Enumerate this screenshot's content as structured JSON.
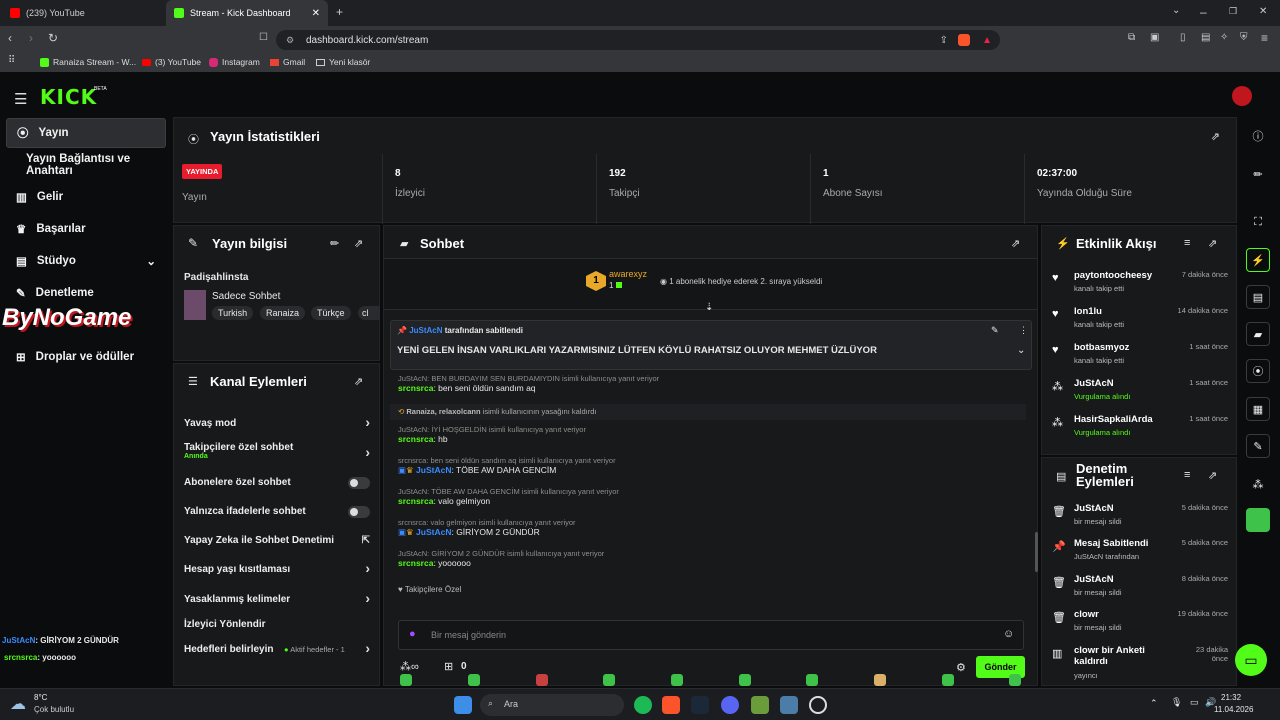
{
  "browser": {
    "tabs": [
      {
        "label": "(239) YouTube"
      },
      {
        "label": "Stream - Kick Dashboard"
      }
    ],
    "url": "dashboard.kick.com/stream",
    "bookmarks": [
      "Ranaiza Stream - W...",
      "(3) YouTube",
      "Instagram",
      "Gmail",
      "Yeni klasör"
    ]
  },
  "header": {
    "logo": "KICK",
    "beta": "BETA"
  },
  "sidebar": {
    "items": [
      {
        "label": "Yayın"
      },
      {
        "label": "Yayın Bağlantısı ve Anahtarı"
      },
      {
        "label": "Gelir"
      },
      {
        "label": "Başarılar"
      },
      {
        "label": "Stüdyo"
      },
      {
        "label": "Denetleme"
      },
      {
        "label": "Droplar ve ödüller"
      }
    ],
    "watermark": "ByNoGame",
    "chat_overlay": [
      {
        "user": "JuStAcN",
        "text": ": GİRİYOM 2 GÜNDÜR"
      },
      {
        "user": "srcnsrca",
        "text": ": yoooooo"
      }
    ]
  },
  "stats": {
    "title": "Yayın İstatistikleri",
    "live_badge": "YAYINDA",
    "live_label": "Yayın",
    "items": [
      {
        "value": "8",
        "label": "İzleyici"
      },
      {
        "value": "192",
        "label": "Takipçi"
      },
      {
        "value": "1",
        "label": "Abone Sayısı"
      },
      {
        "value": "02:37:00",
        "label": "Yayında Olduğu Süre"
      }
    ]
  },
  "stream_info": {
    "title": "Yayın bilgisi",
    "stream_title": "Padişahlinsta",
    "category": "Sadece Sohbet",
    "tags": [
      "Turkish",
      "Ranaiza",
      "Türkçe",
      "cl"
    ]
  },
  "channel_actions": {
    "title": "Kanal Eylemleri",
    "items": [
      {
        "label": "Yavaş mod",
        "sub": ""
      },
      {
        "label": "Takipçilere özel sohbet",
        "sub": "Anında"
      },
      {
        "label": "Abonelere özel sohbet",
        "sub": ""
      },
      {
        "label": "Yalnızca ifadelerle sohbet",
        "sub": ""
      },
      {
        "label": "Yapay Zeka ile Sohbet Denetimi",
        "sub": ""
      },
      {
        "label": "Hesap yaşı kısıtlaması",
        "sub": ""
      },
      {
        "label": "Yasaklanmış kelimeler",
        "sub": ""
      },
      {
        "label": "İzleyici Yönlendir",
        "sub": ""
      },
      {
        "label": "Hedefleri belirleyin",
        "sub": "Aktif hedefler - 1"
      }
    ]
  },
  "chat": {
    "title": "Sohbet",
    "gift_user": "awarexyz",
    "gift_count": "1",
    "gift_text": "1 abonelik hediye ederek 2. sıraya yükseldi",
    "pinned_by_user": "JuStAcN",
    "pinned_by_text": "tarafından sabitlendi",
    "pinned_message": "YENİ GELEN İNSAN VARLIKLARI YAZARMISINIZ LÜTFEN KÖYLÜ RAHATSIZ OLUYOR MEHMET ÜZLÜYOR",
    "messages": [
      {
        "reply": "JuStAcN: BEN BURDAYIM SEN BURDAMIYDIN isimli kullanıcıya yanıt veriyor",
        "user": "srcnsrca",
        "text": ": ben seni öldün sandım aq"
      },
      {
        "reply": "",
        "user": "Ranaiza, relaxolcann",
        "text": "isimli kullanıcının yasağını kaldırdı"
      },
      {
        "reply": "JuStAcN: İYİ HOŞGELDİN isimli kullanıcıya yanıt veriyor",
        "user": "srcnsrca",
        "text": ": hb"
      },
      {
        "reply": "srcnsrca: ben seni öldün sandım aq isimli kullanıcıya yanıt veriyor",
        "user": "JuStAcN",
        "text": ": TÖBE AW DAHA GENCİM"
      },
      {
        "reply": "JuStAcN: TÖBE AW DAHA GENCİM isimli kullanıcıya yanıt veriyor",
        "user": "srcnsrca",
        "text": ": valo gelmiyon"
      },
      {
        "reply": "srcnsrca: valo gelmiyon isimli kullanıcıya yanıt veriyor",
        "user": "JuStAcN",
        "text": ": GİRİYOM 2 GÜNDÜR"
      },
      {
        "reply": "JuStAcN: GİRİYOM 2 GÜNDÜR isimli kullanıcıya yanıt veriyor",
        "user": "srcnsrca",
        "text": ": yoooooo"
      }
    ],
    "followers_only": "Takipçilere Özel",
    "input_placeholder": "Bir mesaj gönderin",
    "send_label": "Gönder",
    "points": "0"
  },
  "activity": {
    "title": "Etkinlik Akışı",
    "items": [
      {
        "name": "paytontoocheesy",
        "sub": "kanalı takip etti",
        "time": "7 dakika önce",
        "icon": "heart-icon"
      },
      {
        "name": "lon1lu",
        "sub": "kanalı takip etti",
        "time": "14 dakika önce",
        "icon": "heart-icon"
      },
      {
        "name": "botbasmyoz",
        "sub": "kanalı takip etti",
        "time": "1 saat önce",
        "icon": "heart-icon"
      },
      {
        "name": "JuStAcN",
        "sub": "Vurgulama alındı",
        "time": "1 saat önce",
        "icon": "coins-icon"
      },
      {
        "name": "HasirSapkaliArda",
        "sub": "Vurgulama alındı",
        "time": "1 saat önce",
        "icon": "coins-icon"
      }
    ]
  },
  "moderation": {
    "title": "Denetim Eylemleri",
    "items": [
      {
        "name": "JuStAcN",
        "sub": "bir mesajı sildi",
        "time": "5 dakika önce",
        "icon": "trash-icon"
      },
      {
        "name": "Mesaj Sabitlendi",
        "sub": "JuStAcN tarafından",
        "time": "5 dakika önce",
        "icon": "pin-icon"
      },
      {
        "name": "JuStAcN",
        "sub": "bir mesajı sildi",
        "time": "8 dakika önce",
        "icon": "trash-icon"
      },
      {
        "name": "clowr",
        "sub": "bir mesajı sildi",
        "time": "19 dakika önce",
        "icon": "trash-icon"
      },
      {
        "name": "clowr bir Anketi kaldırdı",
        "sub": "yayıncı",
        "time": "23 dakika önce",
        "icon": "poll-icon"
      }
    ]
  },
  "taskbar": {
    "weather_temp": "8°C",
    "weather_desc": "Çok bulutlu",
    "search": "Ara",
    "time": "21:32",
    "date": "11.04.2026"
  },
  "colors": {
    "accent": "#53fc18",
    "panel": "#18191b",
    "bg": "#0b0c0d",
    "live": "#e81c2c"
  }
}
